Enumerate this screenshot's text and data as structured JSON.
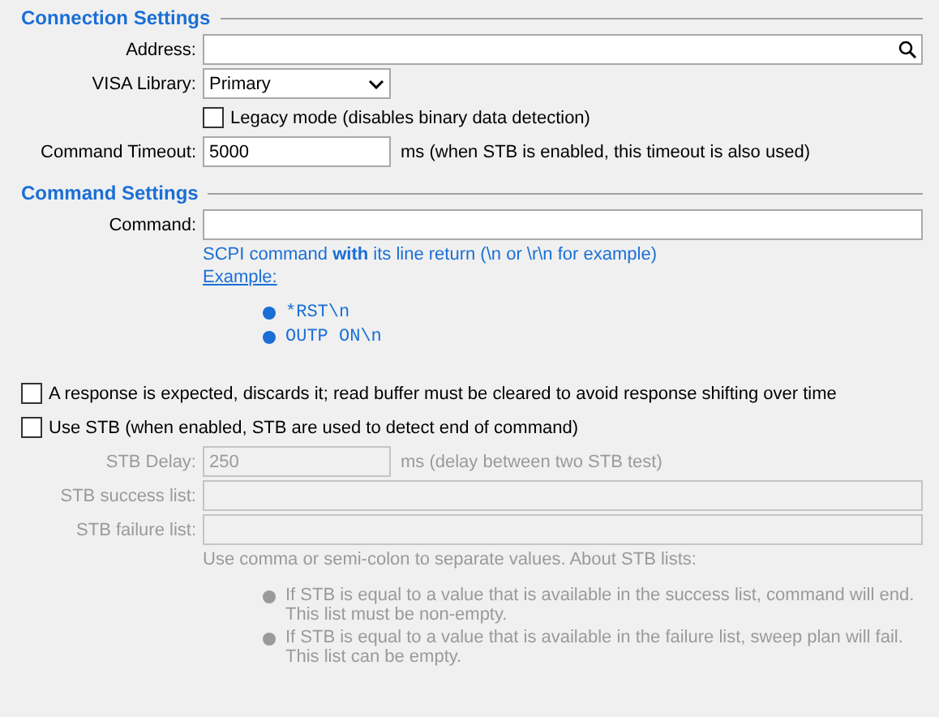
{
  "connection_settings": {
    "title": "Connection Settings",
    "address": {
      "label": "Address:"
    },
    "visa_library": {
      "label": "VISA Library:",
      "value": "Primary"
    },
    "legacy_mode": {
      "label": "Legacy mode (disables binary data detection)",
      "checked": false
    },
    "command_timeout": {
      "label": "Command Timeout:",
      "value": "5000",
      "note": "ms (when STB is enabled, this timeout is also used)"
    }
  },
  "command_settings": {
    "title": "Command Settings",
    "command": {
      "label": "Command:"
    },
    "hint": "SCPI command **with** its line return (\\n or \\r\\n for example)",
    "example_link": "Example:",
    "examples": [
      "*RST\\n",
      "OUTP ON\\n"
    ],
    "response_expected": {
      "label": "A response is expected, discards it; read buffer must be cleared to avoid response shifting over time",
      "checked": false
    },
    "use_stb": {
      "label": "Use STB (when enabled, STB are used to detect end of command)",
      "checked": false
    },
    "stb_delay": {
      "label": "STB Delay:",
      "value": "250",
      "note": "ms (delay between two STB test)",
      "disabled": true
    },
    "stb_success_list": {
      "label": "STB success list:",
      "disabled": true
    },
    "stb_failure_list": {
      "label": "STB failure list:",
      "disabled": true
    },
    "stb_note": "Use comma or semi-colon to separate values. About STB lists:",
    "stb_rules": [
      {
        "lines": [
          "If STB is equal to a value that is available in the success list, command will end.",
          "This list must be non-empty."
        ]
      },
      {
        "lines": [
          "If STB is equal to a value that is available in the failure list, sweep plan will fail.",
          "This list can be empty."
        ]
      }
    ]
  }
}
